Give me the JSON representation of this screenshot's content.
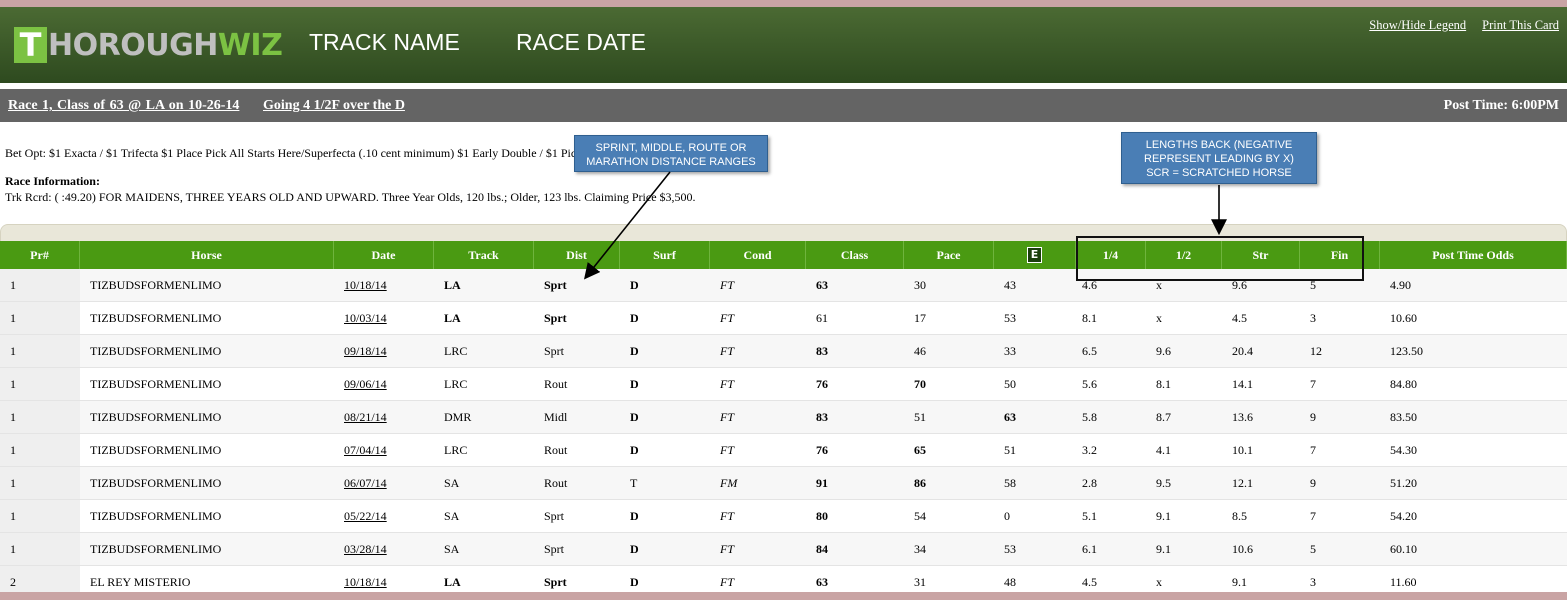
{
  "header": {
    "logo_t": "T",
    "logo_mid": "HOROUGH",
    "logo_end": "WIZ",
    "track_name": "TRACK NAME",
    "race_date": "RACE DATE",
    "show_hide_legend": "Show/Hide Legend",
    "print_card": "Print This Card"
  },
  "race_bar": {
    "title": "Race 1, Class of 63 @ LA on 10-26-14",
    "going": "Going 4 1/2F over the D",
    "post_time": "Post Time: 6:00PM"
  },
  "info": {
    "bet_opt": "Bet Opt: $1 Exacta / $1 Trifecta $1 Place Pick All Starts Here/Superfecta (.10 cent minimum) $1 Early Double / $1 Pic",
    "race_info_label": "Race Information:",
    "race_info_text": "Trk Rcrd: ( :49.20) FOR MAIDENS, THREE YEARS OLD AND UPWARD. Three Year Olds, 120 lbs.; Older, 123 lbs. Claiming Price $3,500."
  },
  "callouts": {
    "distance": "SPRINT, MIDDLE, ROUTE OR\nMARATHON DISTANCE RANGES",
    "lengths": "LENGTHS BACK (NEGATIVE\nREPRESENT LEADING BY X)\nSCR = SCRATCHED HORSE"
  },
  "table": {
    "headers": {
      "pr": "Pr#",
      "horse": "Horse",
      "date": "Date",
      "track": "Track",
      "dist": "Dist",
      "surf": "Surf",
      "cond": "Cond",
      "class": "Class",
      "pace": "Pace",
      "e": "E",
      "q1": "1/4",
      "q2": "1/2",
      "str": "Str",
      "fin": "Fin",
      "odds": "Post Time Odds"
    },
    "rows": [
      {
        "pr": "1",
        "horse": "TIZBUDSFORMENLIMO",
        "date": "10/18/14",
        "track": "LA",
        "dist": "Sprt",
        "surf": "D",
        "cond": "FT",
        "class": "63",
        "pace": "30",
        "e": "43",
        "q1": "4.6",
        "q2": "x",
        "str": "9.6",
        "fin": "5",
        "odds": "4.90"
      },
      {
        "pr": "1",
        "horse": "TIZBUDSFORMENLIMO",
        "date": "10/03/14",
        "track": "LA",
        "dist": "Sprt",
        "surf": "D",
        "cond": "FT",
        "class": "61",
        "pace": "17",
        "e": "53",
        "q1": "8.1",
        "q2": "x",
        "str": "4.5",
        "fin": "3",
        "odds": "10.60"
      },
      {
        "pr": "1",
        "horse": "TIZBUDSFORMENLIMO",
        "date": "09/18/14",
        "track": "LRC",
        "dist": "Sprt",
        "surf": "D",
        "cond": "FT",
        "class": "83",
        "pace": "46",
        "e": "33",
        "q1": "6.5",
        "q2": "9.6",
        "str": "20.4",
        "fin": "12",
        "odds": "123.50"
      },
      {
        "pr": "1",
        "horse": "TIZBUDSFORMENLIMO",
        "date": "09/06/14",
        "track": "LRC",
        "dist": "Rout",
        "surf": "D",
        "cond": "FT",
        "class": "76",
        "pace": "70",
        "e": "50",
        "q1": "5.6",
        "q2": "8.1",
        "str": "14.1",
        "fin": "7",
        "odds": "84.80"
      },
      {
        "pr": "1",
        "horse": "TIZBUDSFORMENLIMO",
        "date": "08/21/14",
        "track": "DMR",
        "dist": "Midl",
        "surf": "D",
        "cond": "FT",
        "class": "83",
        "pace": "51",
        "e": "63",
        "q1": "5.8",
        "q2": "8.7",
        "str": "13.6",
        "fin": "9",
        "odds": "83.50"
      },
      {
        "pr": "1",
        "horse": "TIZBUDSFORMENLIMO",
        "date": "07/04/14",
        "track": "LRC",
        "dist": "Rout",
        "surf": "D",
        "cond": "FT",
        "class": "76",
        "pace": "65",
        "e": "51",
        "q1": "3.2",
        "q2": "4.1",
        "str": "10.1",
        "fin": "7",
        "odds": "54.30"
      },
      {
        "pr": "1",
        "horse": "TIZBUDSFORMENLIMO",
        "date": "06/07/14",
        "track": "SA",
        "dist": "Rout",
        "surf": "T",
        "cond": "FM",
        "class": "91",
        "pace": "86",
        "e": "58",
        "q1": "2.8",
        "q2": "9.5",
        "str": "12.1",
        "fin": "9",
        "odds": "51.20"
      },
      {
        "pr": "1",
        "horse": "TIZBUDSFORMENLIMO",
        "date": "05/22/14",
        "track": "SA",
        "dist": "Sprt",
        "surf": "D",
        "cond": "FT",
        "class": "80",
        "pace": "54",
        "e": "0",
        "q1": "5.1",
        "q2": "9.1",
        "str": "8.5",
        "fin": "7",
        "odds": "54.20"
      },
      {
        "pr": "1",
        "horse": "TIZBUDSFORMENLIMO",
        "date": "03/28/14",
        "track": "SA",
        "dist": "Sprt",
        "surf": "D",
        "cond": "FT",
        "class": "84",
        "pace": "34",
        "e": "53",
        "q1": "6.1",
        "q2": "9.1",
        "str": "10.6",
        "fin": "5",
        "odds": "60.10"
      },
      {
        "pr": "2",
        "horse": "EL REY MISTERIO",
        "date": "10/18/14",
        "track": "LA",
        "dist": "Sprt",
        "surf": "D",
        "cond": "FT",
        "class": "63",
        "pace": "31",
        "e": "48",
        "q1": "4.5",
        "q2": "x",
        "str": "9.1",
        "fin": "3",
        "odds": "11.60"
      }
    ]
  },
  "colors": {
    "header_green": "#2e4a1f",
    "table_head_green": "#4a9a12",
    "logo_green": "#7cc243",
    "race_bar_gray": "#646464",
    "callout_blue": "#4a7eb5",
    "strip_rose": "#c9a4a4"
  }
}
